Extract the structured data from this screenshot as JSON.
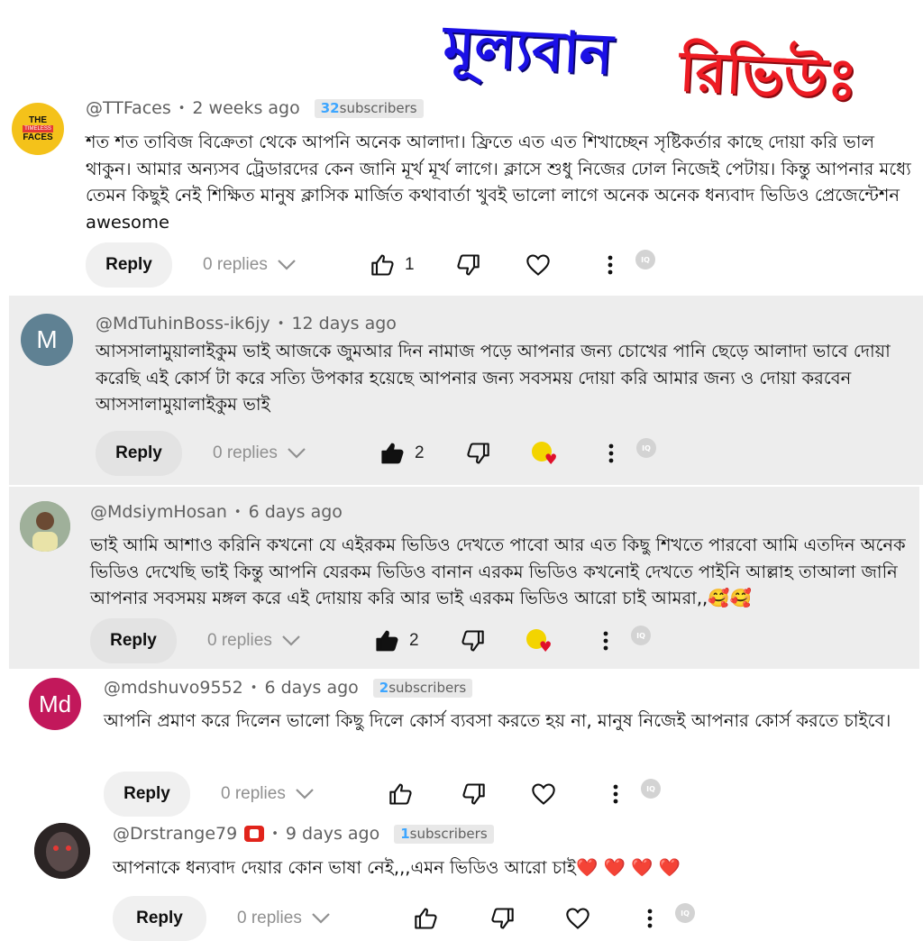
{
  "banner": {
    "word1": "মূল্যবান",
    "word2": "রিভিউঃ"
  },
  "comments": [
    {
      "handle": "@TTFaces",
      "time": "2 weeks ago",
      "subscribers_count": "32",
      "subscribers_label": "subscribers",
      "avatar_text": [
        "THE",
        "TIMELESS",
        "FACES"
      ],
      "text": "শত শত তাবিজ বিক্রেতা থেকে আপনি অনেক আলাদা। ফ্রিতে এত এত শিখাচ্ছেন সৃষ্টিকর্তার কাছে দোয়া করি ভাল থাকুন। আমার অন্যসব ট্রেডারদের কেন জানি মূর্খ মূর্খ লাগে। ক্লাসে শুধু নিজের ঢোল নিজেই পেটায়। কিন্তু আপনার মধ্যে তেমন কিছুই নেই শিক্ষিত মানুষ ক্লাসিক মার্জিত কথাবার্তা খুবই ভালো লাগে অনেক অনেক ধন্যবাদ ভিডিও প্রেজেন্টেশন awesome",
      "reply_label": "Reply",
      "replies": "0 replies",
      "likes": "1"
    },
    {
      "handle": "@MdTuhinBoss-ik6jy",
      "time": "12 days ago",
      "avatar_text": "M",
      "text": "আসসালামুয়ালাইকুম ভাই আজকে জুমআর দিন নামাজ পড়ে আপনার জন্য চোখের পানি ছেড়ে আলাদা ভাবে দোয়া করেছি এই কোর্স টা করে সত্যি উপকার হয়েছে আপনার জন্য সবসময় দোয়া করি আমার জন্য ও দোয়া করবেন আসসালামুয়ালাইকুম ভাই",
      "reply_label": "Reply",
      "replies": "0 replies",
      "likes": "2"
    },
    {
      "handle": "@MdsiymHosan",
      "time": "6 days ago",
      "text": "ভাই আমি আশাও করিনি কখনো যে এইরকম ভিডিও দেখতে পাবো আর এত কিছু শিখতে পারবো আমি এতদিন অনেক ভিডিও দেখেছি ভাই কিন্তু আপনি যেরকম ভিডিও বানান এরকম ভিডিও কখনোই দেখতে পাইনি আল্লাহ তাআলা জানি আপনার সবসময় মঙ্গল করে এই দোয়ায় করি আর ভাই এরকম ভিডিও আরো চাই আমরা,,🥰🥰",
      "reply_label": "Reply",
      "replies": "0 replies",
      "likes": "2"
    },
    {
      "handle": "@mdshuvo9552",
      "time": "6 days ago",
      "subscribers_count": "2",
      "subscribers_label": "subscribers",
      "avatar_text": "Md",
      "text": "আপনি প্রমাণ করে দিলেন ভালো কিছু দিলে কোর্স ব্যবসা করতে হয় না, মানুষ নিজেই আপনার কোর্স করতে চাইবে।",
      "reply_label": "Reply",
      "replies": "0 replies"
    },
    {
      "handle": "@Drstrange79",
      "time": "9 days ago",
      "subscribers_count": "1",
      "subscribers_label": "subscribers",
      "text": "আপনাকে ধন্যবাদ দেয়ার কোন ভাষা নেই,,,এমন ভিডিও আরো চাই❤️ ❤️ ❤️ ❤️",
      "reply_label": "Reply",
      "replies": "0 replies"
    }
  ],
  "colors": {
    "banner_blue": "#1b10e6",
    "banner_red": "#ee1c24",
    "card_grey": "#ededed",
    "subscriber_count": "#3ea6ff",
    "avatar_m": "#5f8193",
    "avatar_md": "#c2185b"
  },
  "icons": [
    "thumb-up-icon",
    "thumb-down-icon",
    "heart-icon",
    "more-vert-icon",
    "chevron-down-icon",
    "creator-heart-icon"
  ]
}
